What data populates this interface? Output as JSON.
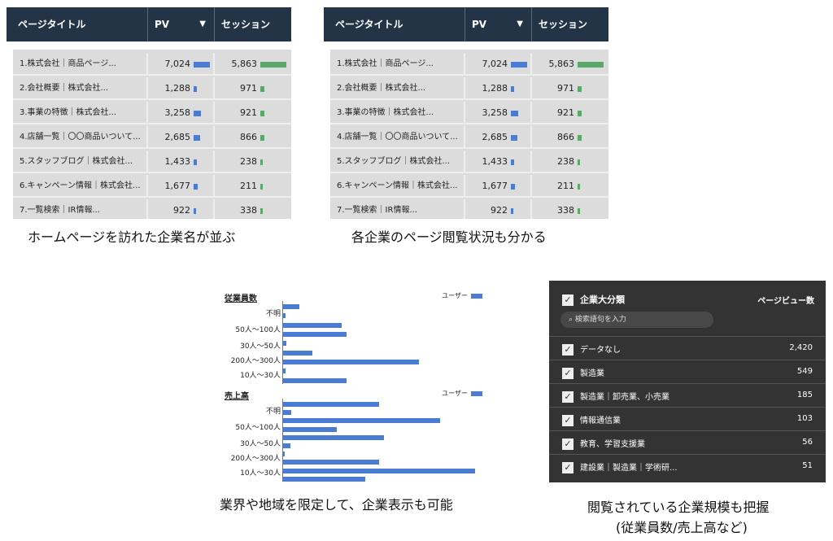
{
  "table_header": {
    "title": "ページタイトル",
    "pv": "PV",
    "sort": "▼",
    "session": "セッション"
  },
  "table_rows": [
    {
      "title": "1.株式会社｜商品ページ...",
      "pv": "7,024",
      "pv_value": 7024,
      "session": "5,863",
      "session_value": 5863
    },
    {
      "title": "2.会社概要｜株式会社...",
      "pv": "1,288",
      "pv_value": 1288,
      "session": "971",
      "session_value": 971
    },
    {
      "title": "3.事業の特徴｜株式会社...",
      "pv": "3,258",
      "pv_value": 3258,
      "session": "921",
      "session_value": 921
    },
    {
      "title": "4.店舗一覧｜〇〇商品いついて...",
      "pv": "2,685",
      "pv_value": 2685,
      "session": "866",
      "session_value": 866
    },
    {
      "title": "5.スタッフブログ｜株式会社...",
      "pv": "1,433",
      "pv_value": 1433,
      "session": "238",
      "session_value": 238
    },
    {
      "title": "6.キャンペーン情報｜株式会社...",
      "pv": "1,677",
      "pv_value": 1677,
      "session": "211",
      "session_value": 211
    },
    {
      "title": "7.一覧検索｜IR情報...",
      "pv": "922",
      "pv_value": 922,
      "session": "338",
      "session_value": 338
    }
  ],
  "captions": {
    "left": "ホームページを訪れた企業名が並ぶ",
    "right": "各企業のページ閲覧状況も分かる",
    "chart": "業界や地域を限定して、企業表示も可能",
    "dark_line1": "閲覧されている企業規模も把握",
    "dark_line2": "(従業員数/売上高など)"
  },
  "chart_data": [
    {
      "type": "bar",
      "title": "従業員数",
      "legend": "ユーザー",
      "labels": [
        "不明",
        "50人〜100人",
        "30人〜50人",
        "200人〜300人",
        "10人〜30人"
      ],
      "values": [
        20,
        3,
        72,
        78,
        4,
        36,
        167,
        3,
        78
      ]
    },
    {
      "type": "bar",
      "title": "売上高",
      "legend": "ユーザー",
      "labels": [
        "不明",
        "50人〜100人",
        "30人〜50人",
        "200人〜300人",
        "10人〜30人"
      ],
      "values": [
        118,
        10,
        193,
        66,
        124,
        9,
        2,
        118,
        236,
        101
      ]
    }
  ],
  "dark_panel": {
    "title": "企業大分類",
    "right_header": "ページビュー数",
    "search_placeholder": "検索語句を入力",
    "rows": [
      {
        "label": "データなし",
        "value": "2,420"
      },
      {
        "label": "製造業",
        "value": "549"
      },
      {
        "label": "製造業｜卸売業、小売業",
        "value": "185"
      },
      {
        "label": "情報通信業",
        "value": "103"
      },
      {
        "label": "教育、学習支援業",
        "value": "56"
      },
      {
        "label": "建設業｜製造業｜学術研...",
        "value": "51"
      }
    ]
  }
}
